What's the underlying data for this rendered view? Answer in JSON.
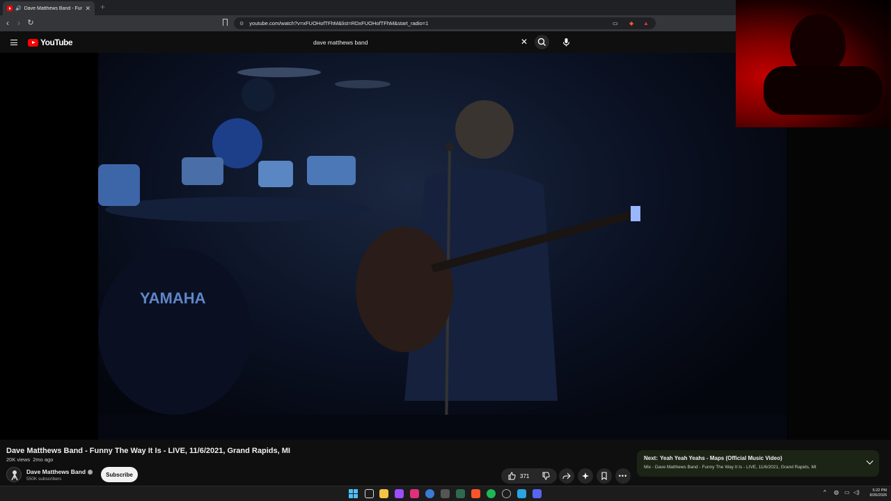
{
  "browser": {
    "tab_title": "Dave Matthews Band - Funny",
    "url": "youtube.com/watch?v=xFUOHofTFhM&list=RDxFUOHofTFhM&start_radio=1"
  },
  "youtube": {
    "logo_text": "YouTube",
    "search_value": "dave matthews band"
  },
  "video": {
    "title": "Dave Matthews Band - Funny The Way It Is - LIVE, 11/6/2021, Grand Rapids, MI",
    "views": "20K views",
    "age": "2mo ago",
    "channel": "Dave Matthews Band",
    "subscribers": "550K subscribers",
    "subscribe_label": "Subscribe",
    "likes": "371",
    "stage_text": "YAMAHA"
  },
  "up_next": {
    "prefix": "Next:",
    "title": "Yeah Yeah Yeahs - Maps (Official Music Video)",
    "mix": "Mix - Dave Matthews Band - Funny The Way It Is - LIVE, 11/6/2021, Grand Rapids, MI"
  },
  "taskbar": {
    "time": "5:22 PM",
    "date": "8/26/2026"
  },
  "colors": {
    "youtube_red": "#ff0000",
    "page_bg": "#0f0f0f",
    "up_next_bg": "#1b2415"
  }
}
